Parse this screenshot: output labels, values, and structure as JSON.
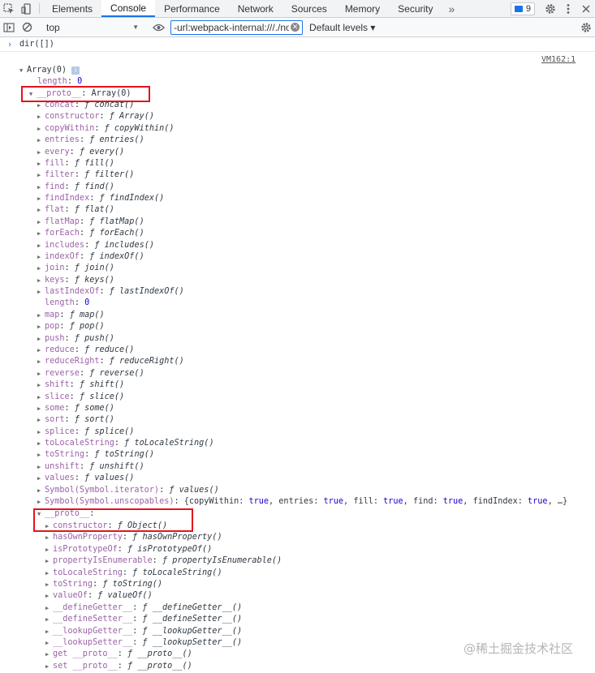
{
  "tabs": {
    "items": [
      "Elements",
      "Console",
      "Performance",
      "Network",
      "Sources",
      "Memory",
      "Security"
    ],
    "more": "»",
    "issues_count": "9",
    "active": "Console"
  },
  "console_toolbar": {
    "context": "top",
    "filter_value": "-url:webpack-internal:///./nod",
    "levels": "Default levels ▾"
  },
  "command": {
    "prompt": "›",
    "text": "dir([])"
  },
  "source_link": "VM162:1",
  "tree": {
    "root": "Array(0)",
    "length_key": "length",
    "length_val": "0",
    "proto_key": "__proto__",
    "proto_val": "Array(0)",
    "array_methods": [
      {
        "k": "concat",
        "v": "concat()"
      },
      {
        "k": "constructor",
        "v": "Array()"
      },
      {
        "k": "copyWithin",
        "v": "copyWithin()"
      },
      {
        "k": "entries",
        "v": "entries()"
      },
      {
        "k": "every",
        "v": "every()"
      },
      {
        "k": "fill",
        "v": "fill()"
      },
      {
        "k": "filter",
        "v": "filter()"
      },
      {
        "k": "find",
        "v": "find()"
      },
      {
        "k": "findIndex",
        "v": "findIndex()"
      },
      {
        "k": "flat",
        "v": "flat()"
      },
      {
        "k": "flatMap",
        "v": "flatMap()"
      },
      {
        "k": "forEach",
        "v": "forEach()"
      },
      {
        "k": "includes",
        "v": "includes()"
      },
      {
        "k": "indexOf",
        "v": "indexOf()"
      },
      {
        "k": "join",
        "v": "join()"
      },
      {
        "k": "keys",
        "v": "keys()"
      },
      {
        "k": "lastIndexOf",
        "v": "lastIndexOf()"
      },
      {
        "k": "length",
        "v": "0",
        "plain": true
      },
      {
        "k": "map",
        "v": "map()"
      },
      {
        "k": "pop",
        "v": "pop()"
      },
      {
        "k": "push",
        "v": "push()"
      },
      {
        "k": "reduce",
        "v": "reduce()"
      },
      {
        "k": "reduceRight",
        "v": "reduceRight()"
      },
      {
        "k": "reverse",
        "v": "reverse()"
      },
      {
        "k": "shift",
        "v": "shift()"
      },
      {
        "k": "slice",
        "v": "slice()"
      },
      {
        "k": "some",
        "v": "some()"
      },
      {
        "k": "sort",
        "v": "sort()"
      },
      {
        "k": "splice",
        "v": "splice()"
      },
      {
        "k": "toLocaleString",
        "v": "toLocaleString()"
      },
      {
        "k": "toString",
        "v": "toString()"
      },
      {
        "k": "unshift",
        "v": "unshift()"
      },
      {
        "k": "values",
        "v": "values()"
      },
      {
        "k": "Symbol(Symbol.iterator)",
        "v": "values()"
      },
      {
        "k": "Symbol(Symbol.unscopables)",
        "v": "{copyWithin: true, entries: true, fill: true, find: true, findIndex: true, …}",
        "obj": true
      }
    ],
    "inner_proto_key": "__proto__",
    "object_methods": [
      {
        "k": "constructor",
        "v": "Object()"
      },
      {
        "k": "hasOwnProperty",
        "v": "hasOwnProperty()"
      },
      {
        "k": "isPrototypeOf",
        "v": "isPrototypeOf()"
      },
      {
        "k": "propertyIsEnumerable",
        "v": "propertyIsEnumerable()"
      },
      {
        "k": "toLocaleString",
        "v": "toLocaleString()"
      },
      {
        "k": "toString",
        "v": "toString()"
      },
      {
        "k": "valueOf",
        "v": "valueOf()"
      },
      {
        "k": "__defineGetter__",
        "v": "__defineGetter__()"
      },
      {
        "k": "__defineSetter__",
        "v": "__defineSetter__()"
      },
      {
        "k": "__lookupGetter__",
        "v": "__lookupGetter__()"
      },
      {
        "k": "__lookupSetter__",
        "v": "__lookupSetter__()"
      },
      {
        "k": "get __proto__",
        "v": "__proto__()"
      },
      {
        "k": "set __proto__",
        "v": "__proto__()"
      }
    ]
  },
  "watermark": "@稀土掘金技术社区",
  "colors": {
    "accent": "#1a73e8",
    "highlight_box": "#e2141c",
    "key": "#881391",
    "number": "#1c00cf"
  }
}
